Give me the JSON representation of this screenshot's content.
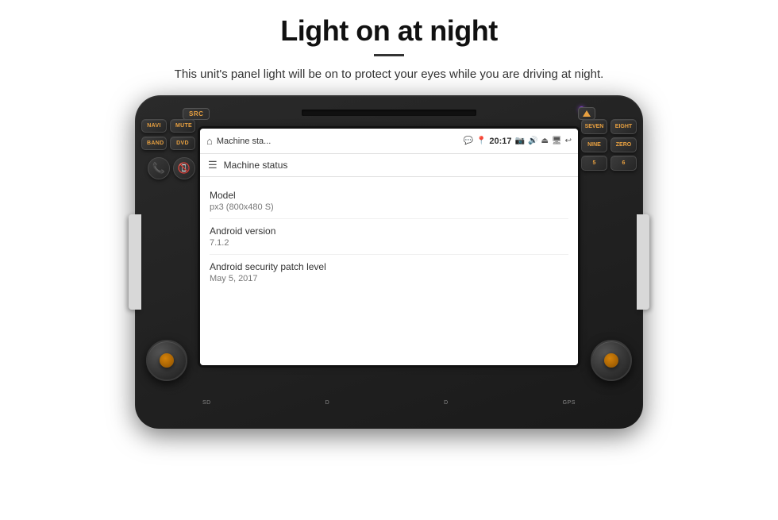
{
  "page": {
    "title": "Light on at night",
    "divider": "—",
    "subtitle": "This unit's panel light will be on to protect your eyes while you are driving at night."
  },
  "head_unit": {
    "buttons": {
      "src": "SRC",
      "navi": "NAVI",
      "mute": "MUTE",
      "band": "BAND",
      "dvd": "DVD",
      "right_numbers": [
        "SEVEN",
        "EIGHT",
        "NINE",
        "ZERO",
        "5",
        "6"
      ]
    },
    "bottom_labels": [
      "SD",
      "D",
      "D",
      "GPS"
    ]
  },
  "android": {
    "status_bar": {
      "app_name": "Machine sta...",
      "time": "20:17"
    },
    "toolbar": {
      "title": "Machine status"
    },
    "info_items": [
      {
        "label": "Model",
        "value": "px3 (800x480 S)"
      },
      {
        "label": "Android version",
        "value": "7.1.2"
      },
      {
        "label": "Android security patch level",
        "value": "May 5, 2017"
      }
    ]
  }
}
